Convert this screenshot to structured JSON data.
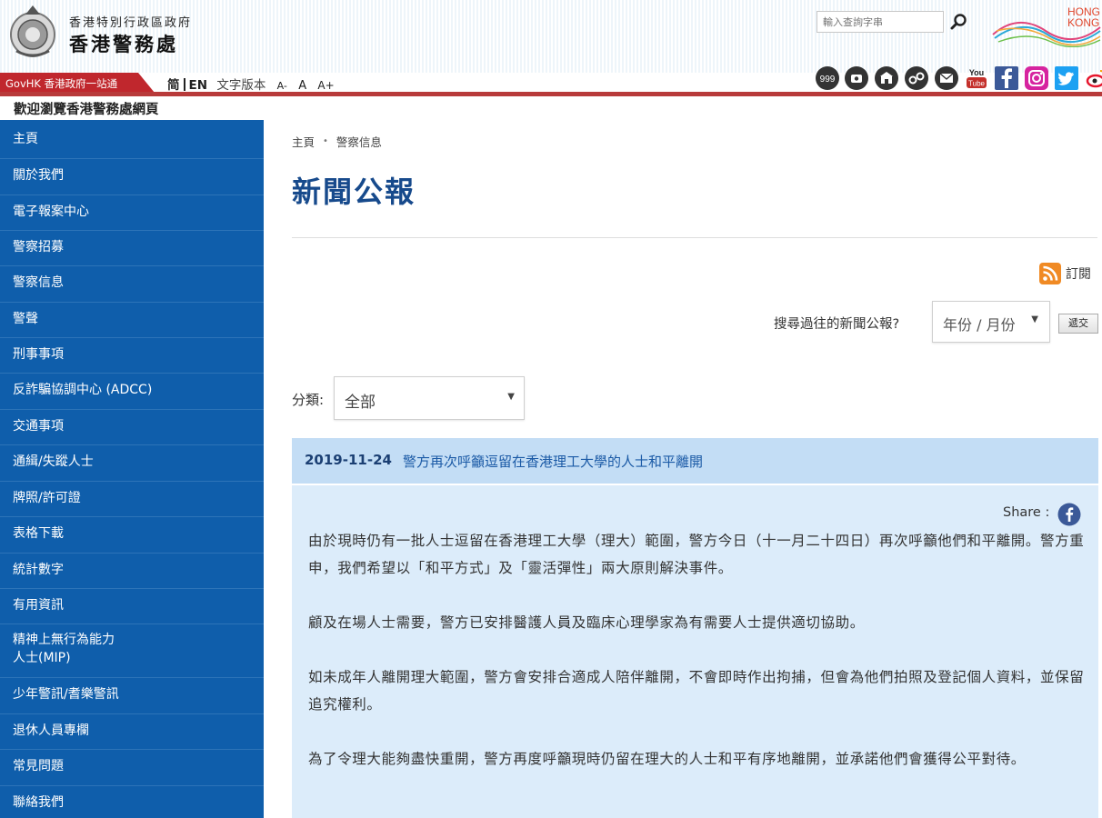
{
  "header": {
    "gov_name": "香港特別行政區政府",
    "dept_name": "香港警務處",
    "search_placeholder": "輸入查詢字串",
    "brand_text_1": "HONG",
    "brand_text_2": "KONG"
  },
  "toolbar": {
    "govhk": "GovHK 香港政府一站通",
    "lang_sc": "简",
    "lang_en": "EN",
    "text_version": "文字版本",
    "font_small": "A-",
    "font_normal": "A",
    "font_large": "A+",
    "icon_999": "999",
    "icon_youtube_1": "You",
    "icon_youtube_2": "Tube"
  },
  "welcome": "歡迎瀏覽香港警務處網頁",
  "sidebar": {
    "items": [
      {
        "label": "主頁"
      },
      {
        "label": "關於我們"
      },
      {
        "label": "電子報案中心"
      },
      {
        "label": "警察招募"
      },
      {
        "label": "警察信息"
      },
      {
        "label": "警聲"
      },
      {
        "label": "刑事事項"
      },
      {
        "label": "反詐騙協調中心 (ADCC)"
      },
      {
        "label": "交通事項"
      },
      {
        "label": "通緝/失蹤人士"
      },
      {
        "label": "牌照/許可證"
      },
      {
        "label": "表格下載"
      },
      {
        "label": "統計數字"
      },
      {
        "label": "有用資訊"
      },
      {
        "label": "精神上無行為能力",
        "label2": "人士(MIP)"
      },
      {
        "label": "少年警訊/耆樂警訊"
      },
      {
        "label": "退休人員專欄"
      },
      {
        "label": "常見問題"
      },
      {
        "label": "聯絡我們"
      }
    ]
  },
  "breadcrumb": {
    "home": "主頁",
    "section": "警察信息"
  },
  "page_title": "新聞公報",
  "subscribe": "訂閱",
  "search_past": {
    "label": "搜尋過往的新聞公報?",
    "select_value": "年份 / 月份",
    "submit": "遞交"
  },
  "category": {
    "label": "分類:",
    "value": "全部"
  },
  "news": {
    "date": "2019-11-24",
    "title": "警方再次呼籲逗留在香港理工大學的人士和平離開",
    "share_label": "Share :",
    "paragraphs": [
      "由於現時仍有一批人士逗留在香港理工大學（理大）範圍，警方今日（十一月二十四日）再次呼籲他們和平離開。警方重申，我們希望以「和平方式」及「靈活彈性」兩大原則解決事件。",
      "顧及在場人士需要，警方已安排醫護人員及臨床心理學家為有需要人士提供適切協助。",
      "如未成年人離開理大範圍，警方會安排合適成人陪伴離開，不會即時作出拘捕，但會為他們拍照及登記個人資料，並保留追究權利。",
      "為了令理大能夠盡快重開，警方再度呼籲現時仍留在理大的人士和平有序地離開，並承諾他們會獲得公平對待。"
    ]
  },
  "colors": {
    "sidebar_bg": "#0f5eab",
    "title_blue": "#174a8c",
    "news_head_bg": "#c3ddf5",
    "news_body_bg": "#dcecfa",
    "accent_red": "#b83a3a"
  },
  "icons": {
    "logo": "police-crest-icon",
    "search": "magnifier-icon",
    "rss": "rss-icon",
    "share": "facebook-icon"
  }
}
